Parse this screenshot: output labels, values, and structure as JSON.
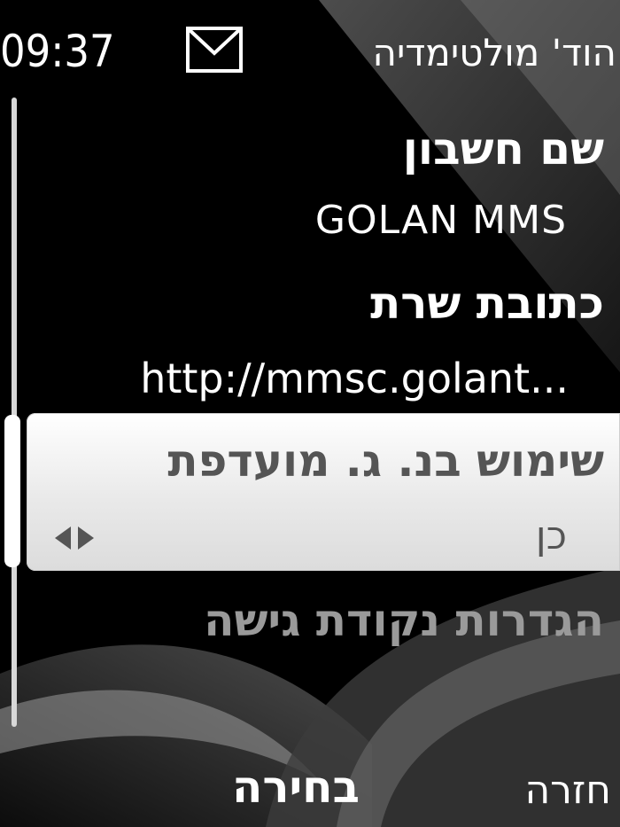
{
  "status_bar": {
    "clock": "09:37",
    "title": "הוד' מולטימדיה",
    "notification_icon": "envelope-icon"
  },
  "settings": [
    {
      "label": "שם חשבון",
      "value": "GOLAN MMS"
    },
    {
      "label": "כתובת שרת",
      "value": "http://mmsc.golant..."
    },
    {
      "label": "שימוש בנ. ג. מועדפת",
      "value": "כן"
    },
    {
      "label": "הגדרות נקודת גישה"
    }
  ],
  "softkeys": {
    "left": "בחירה",
    "right": "חזרה"
  },
  "colors": {
    "background": "#000000",
    "highlight": "#f2f2f2",
    "text": "#ffffff",
    "highlight_text": "#555555",
    "dim_text": "#9a9a9a"
  }
}
